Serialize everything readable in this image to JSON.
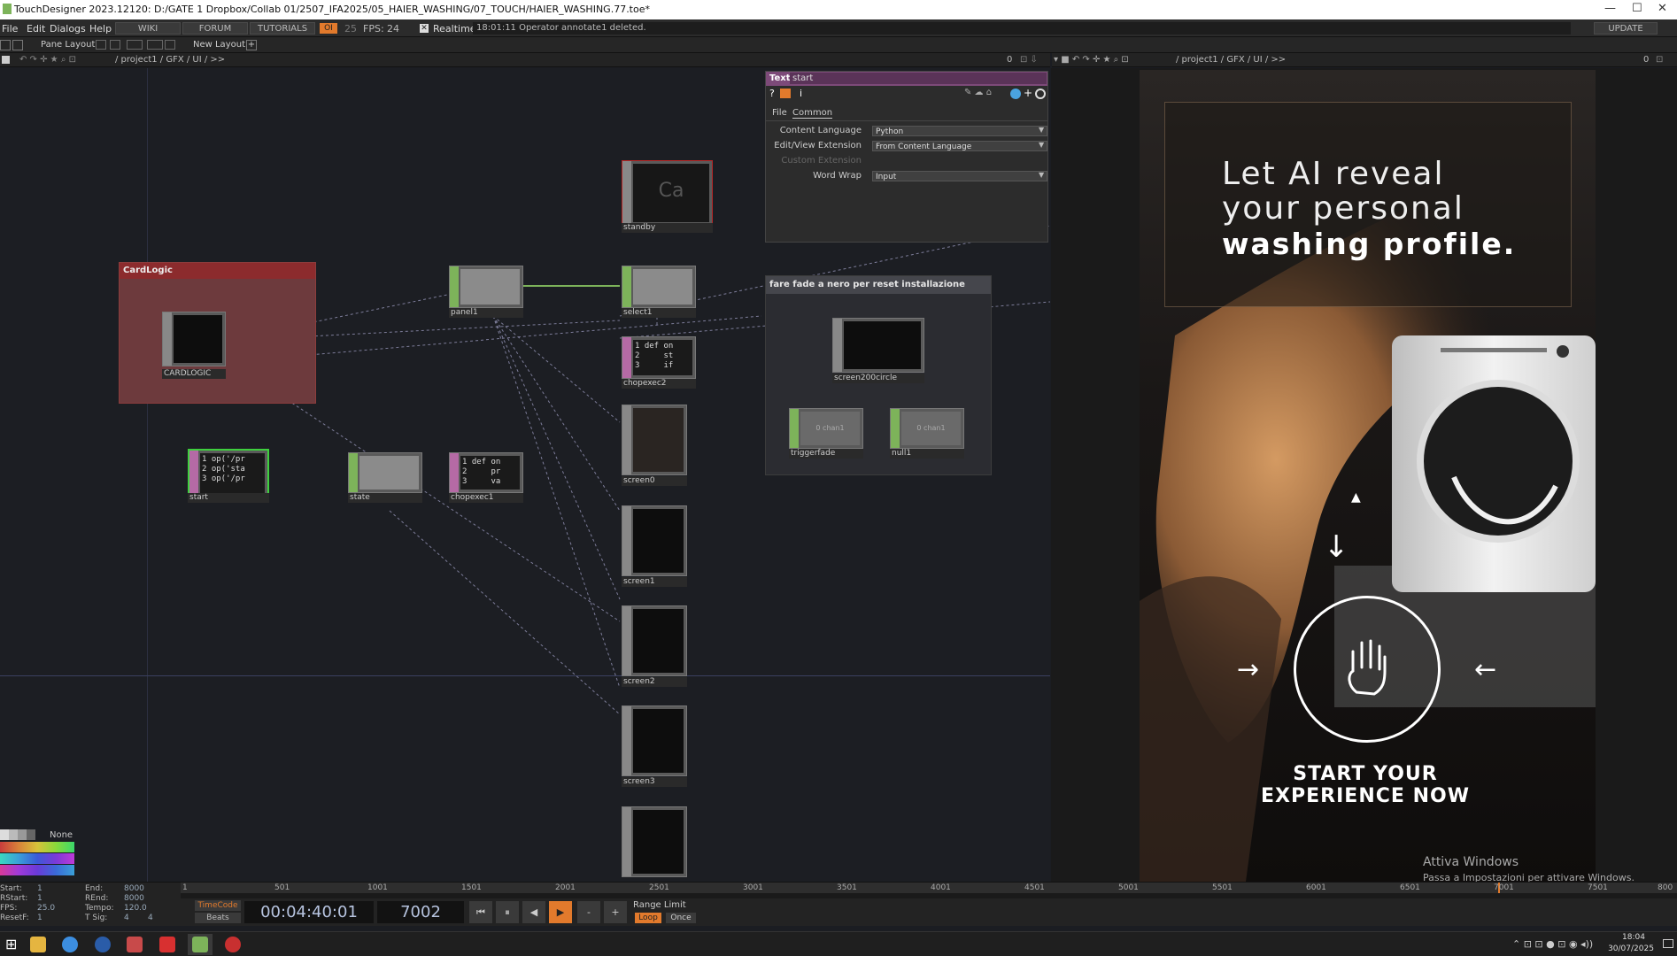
{
  "window": {
    "title": "TouchDesigner 2023.12120: D:/GATE 1 Dropbox/Collab 01/2507_IFA2025/05_HAIER_WASHING/07_TOUCH/HAIER_WASHING.77.toe*"
  },
  "menubar": {
    "items": [
      "File",
      "Edit",
      "Dialogs",
      "Help"
    ],
    "wiki": "WIKI",
    "forum": "FORUM",
    "tutorials": "TUTORIALS",
    "oi": "OI",
    "fps_num": "25",
    "fps_label": "FPS:",
    "fps_val": "24",
    "realtime": "Realtime",
    "status": "18:01:11 Operator annotate1 deleted.",
    "update": "UPDATE"
  },
  "layoutbar": {
    "pane_layout": "Pane Layout",
    "new_layout": "New Layout"
  },
  "pathbar_left": {
    "path": "/ project1 / GFX / UI / >>",
    "count": "0"
  },
  "pathbar_right": {
    "path": "/ project1 / GFX / UI / >>",
    "count": "0"
  },
  "network": {
    "cardlogic": {
      "title": "CardLogic",
      "node": "CARDLOGIC"
    },
    "nodes": {
      "standby": "standby",
      "panel1": "panel1",
      "select1": "select1",
      "chopexec2": "chopexec2",
      "screen0": "screen0",
      "screen1": "screen1",
      "screen2": "screen2",
      "screen3": "screen3",
      "start": "start",
      "state": "state",
      "chopexec1": "chopexec1",
      "screen200circle": "screen200circle",
      "triggerfade": "triggerfade",
      "null1": "null1"
    },
    "chan_text": "0 chan1",
    "code_start": [
      "1 op('/pr",
      "2 op('sta",
      "3 op('/pr"
    ],
    "code_chopexec1": [
      "1 def on",
      "2     pr",
      "3     va"
    ],
    "code_chopexec2": [
      "1 def on",
      "2     st",
      "3     if"
    ],
    "standby_thumb": "Ca",
    "annotate": {
      "title": "fare fade a nero per reset installazione"
    }
  },
  "params": {
    "type": "Text",
    "name": "start",
    "tabs": [
      "File",
      "Common"
    ],
    "rows": [
      {
        "label": "Content Language",
        "value": "Python"
      },
      {
        "label": "Edit/View Extension",
        "value": "From Content Language"
      },
      {
        "label": "Custom Extension",
        "value": ""
      },
      {
        "label": "Word Wrap",
        "value": "Input"
      }
    ]
  },
  "viewer": {
    "headline1": "Let AI reveal",
    "headline2": "your personal",
    "headline3": "washing profile.",
    "cta1": "START YOUR",
    "cta2": "EXPERIENCE NOW",
    "arrow_left": "→",
    "arrow_right": "←",
    "arrow_down": "↓",
    "watermark1": "Attiva Windows",
    "watermark2": "Passa a Impostazioni per attivare Windows."
  },
  "palette": {
    "none": "None"
  },
  "timeline": {
    "start_l": "Start:",
    "start_v": "1",
    "end_l": "End:",
    "end_v": "8000",
    "rstart_l": "RStart:",
    "rstart_v": "1",
    "rend_l": "REnd:",
    "rend_v": "8000",
    "fps_l": "FPS:",
    "fps_v": "25.0",
    "tempo_l": "Tempo:",
    "tempo_v": "120.0",
    "resetf_l": "ResetF:",
    "resetf_v": "1",
    "tsig_l": "T Sig:",
    "tsig_v1": "4",
    "tsig_v2": "4",
    "timecode": "TimeCode",
    "beats": "Beats",
    "clock": "00:04:40:01",
    "frame": "7002",
    "range_limit": "Range Limit",
    "loop": "Loop",
    "once": "Once",
    "ticks": [
      "1",
      "501",
      "1001",
      "1501",
      "2001",
      "2501",
      "3001",
      "3501",
      "4001",
      "4501",
      "5001",
      "5501",
      "6001",
      "6501",
      "7001",
      "7501",
      "800"
    ]
  },
  "taskbar": {
    "time": "18:04",
    "date": "30/07/2025"
  },
  "colors": {
    "accent": "#e27a2c",
    "node_green": "#7db35a",
    "node_pink": "#b56aa5",
    "annot_red": "#8c3c3c"
  }
}
